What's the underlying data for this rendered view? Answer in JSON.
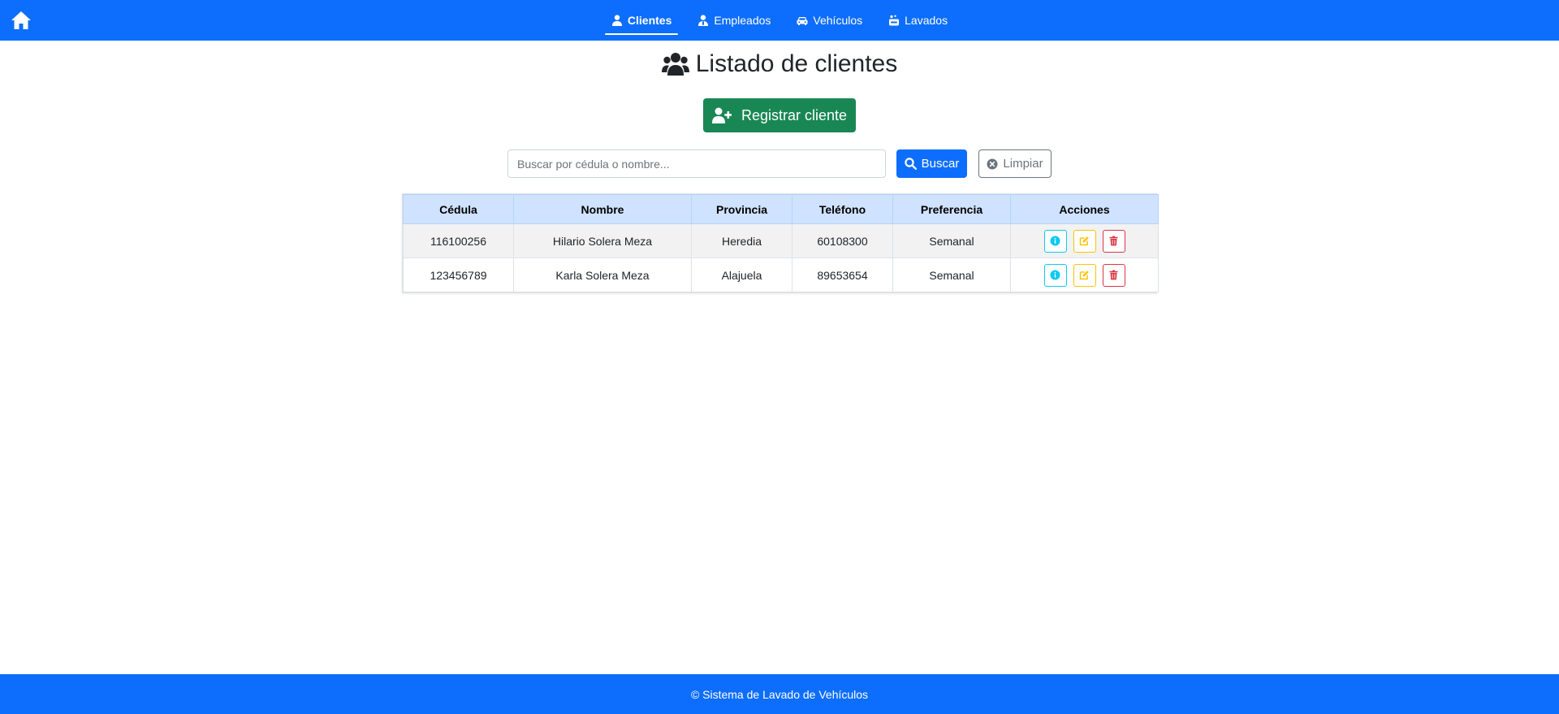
{
  "nav": {
    "home_icon": "home-icon",
    "links": [
      {
        "label": "Clientes",
        "icon": "user-icon",
        "active": true
      },
      {
        "label": "Empleados",
        "icon": "user-tie-icon",
        "active": false
      },
      {
        "label": "Vehículos",
        "icon": "car-icon",
        "active": false
      },
      {
        "label": "Lavados",
        "icon": "soap-icon",
        "active": false
      }
    ]
  },
  "header": {
    "title": "Listado de clientes",
    "title_icon": "users-icon"
  },
  "actions": {
    "register_label": "Registrar cliente",
    "register_icon": "user-plus-icon"
  },
  "search": {
    "placeholder": "Buscar por cédula o nombre...",
    "value": "",
    "search_label": "Buscar",
    "clear_label": "Limpiar"
  },
  "table": {
    "columns": [
      "Cédula",
      "Nombre",
      "Provincia",
      "Teléfono",
      "Preferencia",
      "Acciones"
    ],
    "rows": [
      {
        "cedula": "116100256",
        "nombre": "Hilario Solera Meza",
        "provincia": "Heredia",
        "telefono": "60108300",
        "preferencia": "Semanal"
      },
      {
        "cedula": "123456789",
        "nombre": "Karla Solera Meza",
        "provincia": "Alajuela",
        "telefono": "89653654",
        "preferencia": "Semanal"
      }
    ],
    "row_actions": [
      "info-icon",
      "edit-icon",
      "trash-icon"
    ]
  },
  "footer": {
    "text": "© Sistema de Lavado de Vehículos"
  },
  "colors": {
    "primary": "#0d6efd",
    "success": "#198754",
    "info": "#0dcaf0",
    "warning": "#ffc107",
    "danger": "#dc3545",
    "table_header": "#cfe2ff"
  }
}
